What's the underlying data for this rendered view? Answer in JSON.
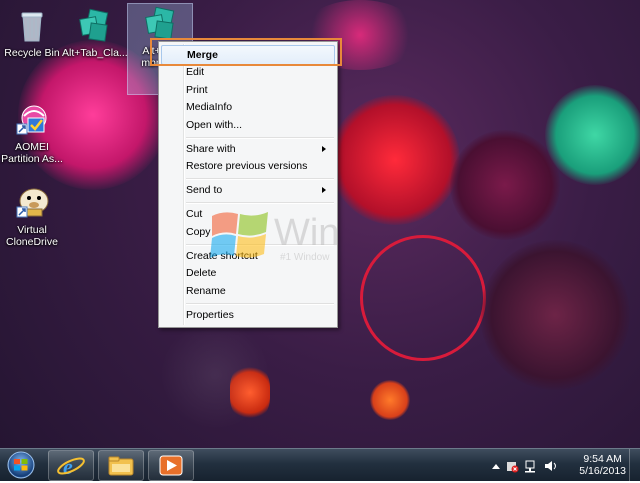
{
  "desktop": {
    "icons": [
      {
        "label": "Recycle Bin",
        "icon": "recycle-bin-icon"
      },
      {
        "label": "Alt+Tab_Cla...",
        "icon": "registry-file-icon"
      },
      {
        "label": "Alt+Tab mbnai...",
        "icon": "registry-file-icon"
      },
      {
        "label": "AOMEI Partition As...",
        "icon": "aomei-app-icon"
      },
      {
        "label": "Virtual CloneDrive",
        "icon": "virtual-clonedrive-icon"
      }
    ]
  },
  "context_menu": {
    "items": [
      {
        "label": "Merge"
      },
      {
        "label": "Edit"
      },
      {
        "label": "Print"
      },
      {
        "label": "MediaInfo"
      },
      {
        "label": "Open with..."
      },
      {
        "label": "Share with"
      },
      {
        "label": "Restore previous versions"
      },
      {
        "label": "Send to"
      },
      {
        "label": "Cut"
      },
      {
        "label": "Copy"
      },
      {
        "label": "Create shortcut"
      },
      {
        "label": "Delete"
      },
      {
        "label": "Rename"
      },
      {
        "label": "Properties"
      }
    ]
  },
  "watermark": {
    "text": "Win",
    "sub": "#1 Window"
  },
  "taskbar": {
    "pinned": [
      "internet-explorer-icon",
      "windows-explorer-icon",
      "media-player-icon"
    ],
    "clock": {
      "time": "9:54 AM",
      "date": "5/16/2013"
    }
  },
  "colors": {
    "highlight_border": "#e8893a",
    "taskbar": "#22303f"
  }
}
